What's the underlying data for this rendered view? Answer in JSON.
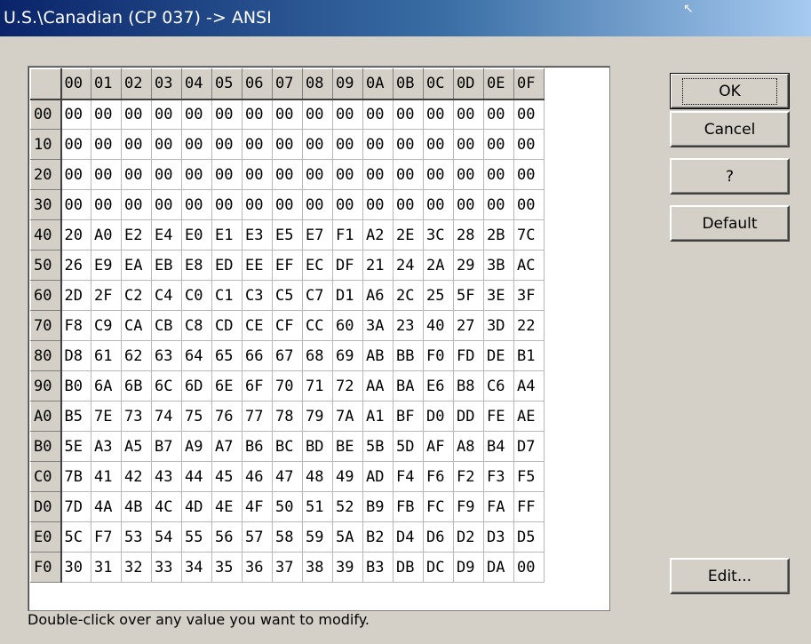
{
  "window": {
    "title": "U.S.\\Canadian (CP 037) -> ANSI"
  },
  "buttons": {
    "ok": "OK",
    "cancel": "Cancel",
    "help": "?",
    "default": "Default",
    "edit": "Edit..."
  },
  "hint": "Double-click over any value you want to modify.",
  "grid": {
    "col_headers": [
      "00",
      "01",
      "02",
      "03",
      "04",
      "05",
      "06",
      "07",
      "08",
      "09",
      "0A",
      "0B",
      "0C",
      "0D",
      "0E",
      "0F"
    ],
    "rows": [
      {
        "label": "00",
        "cells": [
          "00",
          "00",
          "00",
          "00",
          "00",
          "00",
          "00",
          "00",
          "00",
          "00",
          "00",
          "00",
          "00",
          "00",
          "00",
          "00"
        ]
      },
      {
        "label": "10",
        "cells": [
          "00",
          "00",
          "00",
          "00",
          "00",
          "00",
          "00",
          "00",
          "00",
          "00",
          "00",
          "00",
          "00",
          "00",
          "00",
          "00"
        ]
      },
      {
        "label": "20",
        "cells": [
          "00",
          "00",
          "00",
          "00",
          "00",
          "00",
          "00",
          "00",
          "00",
          "00",
          "00",
          "00",
          "00",
          "00",
          "00",
          "00"
        ]
      },
      {
        "label": "30",
        "cells": [
          "00",
          "00",
          "00",
          "00",
          "00",
          "00",
          "00",
          "00",
          "00",
          "00",
          "00",
          "00",
          "00",
          "00",
          "00",
          "00"
        ]
      },
      {
        "label": "40",
        "cells": [
          "20",
          "A0",
          "E2",
          "E4",
          "E0",
          "E1",
          "E3",
          "E5",
          "E7",
          "F1",
          "A2",
          "2E",
          "3C",
          "28",
          "2B",
          "7C"
        ]
      },
      {
        "label": "50",
        "cells": [
          "26",
          "E9",
          "EA",
          "EB",
          "E8",
          "ED",
          "EE",
          "EF",
          "EC",
          "DF",
          "21",
          "24",
          "2A",
          "29",
          "3B",
          "AC"
        ]
      },
      {
        "label": "60",
        "cells": [
          "2D",
          "2F",
          "C2",
          "C4",
          "C0",
          "C1",
          "C3",
          "C5",
          "C7",
          "D1",
          "A6",
          "2C",
          "25",
          "5F",
          "3E",
          "3F"
        ]
      },
      {
        "label": "70",
        "cells": [
          "F8",
          "C9",
          "CA",
          "CB",
          "C8",
          "CD",
          "CE",
          "CF",
          "CC",
          "60",
          "3A",
          "23",
          "40",
          "27",
          "3D",
          "22"
        ]
      },
      {
        "label": "80",
        "cells": [
          "D8",
          "61",
          "62",
          "63",
          "64",
          "65",
          "66",
          "67",
          "68",
          "69",
          "AB",
          "BB",
          "F0",
          "FD",
          "DE",
          "B1"
        ]
      },
      {
        "label": "90",
        "cells": [
          "B0",
          "6A",
          "6B",
          "6C",
          "6D",
          "6E",
          "6F",
          "70",
          "71",
          "72",
          "AA",
          "BA",
          "E6",
          "B8",
          "C6",
          "A4"
        ]
      },
      {
        "label": "A0",
        "cells": [
          "B5",
          "7E",
          "73",
          "74",
          "75",
          "76",
          "77",
          "78",
          "79",
          "7A",
          "A1",
          "BF",
          "D0",
          "DD",
          "FE",
          "AE"
        ]
      },
      {
        "label": "B0",
        "cells": [
          "5E",
          "A3",
          "A5",
          "B7",
          "A9",
          "A7",
          "B6",
          "BC",
          "BD",
          "BE",
          "5B",
          "5D",
          "AF",
          "A8",
          "B4",
          "D7"
        ]
      },
      {
        "label": "C0",
        "cells": [
          "7B",
          "41",
          "42",
          "43",
          "44",
          "45",
          "46",
          "47",
          "48",
          "49",
          "AD",
          "F4",
          "F6",
          "F2",
          "F3",
          "F5"
        ]
      },
      {
        "label": "D0",
        "cells": [
          "7D",
          "4A",
          "4B",
          "4C",
          "4D",
          "4E",
          "4F",
          "50",
          "51",
          "52",
          "B9",
          "FB",
          "FC",
          "F9",
          "FA",
          "FF"
        ]
      },
      {
        "label": "E0",
        "cells": [
          "5C",
          "F7",
          "53",
          "54",
          "55",
          "56",
          "57",
          "58",
          "59",
          "5A",
          "B2",
          "D4",
          "D6",
          "D2",
          "D3",
          "D5"
        ]
      },
      {
        "label": "F0",
        "cells": [
          "30",
          "31",
          "32",
          "33",
          "34",
          "35",
          "36",
          "37",
          "38",
          "39",
          "B3",
          "DB",
          "DC",
          "D9",
          "DA",
          "00"
        ]
      }
    ]
  }
}
